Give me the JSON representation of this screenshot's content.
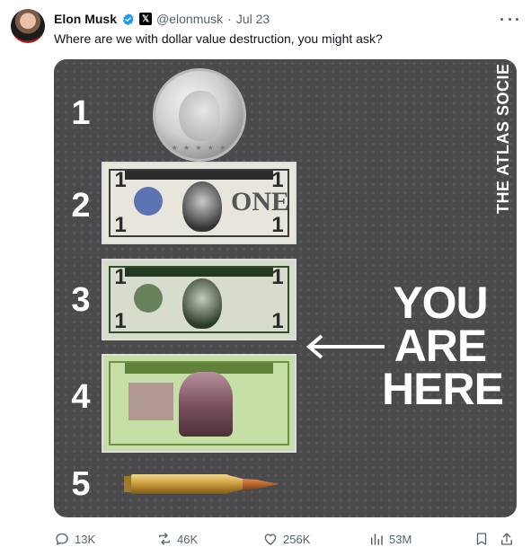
{
  "author": {
    "name": "Elon Musk",
    "handle": "@elonmusk",
    "separator": "·",
    "date": "Jul 23"
  },
  "tweet": {
    "text": "Where are we with dollar value destruction, you might ask?"
  },
  "image": {
    "watermark": "THE ATLAS SOCIETY",
    "numbers": [
      "1",
      "2",
      "3",
      "4",
      "5"
    ],
    "overlay_lines": [
      "YOU",
      "ARE",
      "HERE"
    ],
    "items": [
      "silver-coin",
      "silver-certificate-note",
      "federal-reserve-note",
      "zimbabwe-50-trillion-note",
      "bullet-cartridge"
    ]
  },
  "actions": {
    "replies": "13K",
    "reposts": "46K",
    "likes": "256K",
    "views": "53M"
  },
  "colors": {
    "verified": "#1d9bf0",
    "secondary_text": "#536471",
    "image_background": "#4a4a4c"
  }
}
